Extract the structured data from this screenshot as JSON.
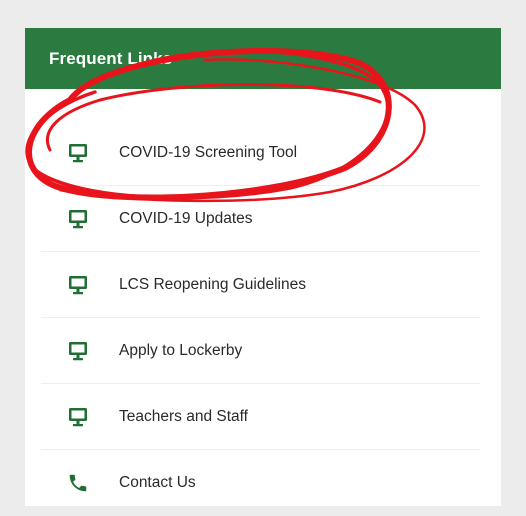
{
  "panel": {
    "title": "Frequent Links",
    "accent_color": "#2b7b40",
    "icon_color": "#1f6e33"
  },
  "links": [
    {
      "label": "COVID-19 Screening Tool",
      "icon": "monitor-icon"
    },
    {
      "label": "COVID-19 Updates",
      "icon": "monitor-icon"
    },
    {
      "label": "LCS Reopening Guidelines",
      "icon": "monitor-icon"
    },
    {
      "label": "Apply to Lockerby",
      "icon": "monitor-icon"
    },
    {
      "label": "Teachers and Staff",
      "icon": "monitor-icon"
    },
    {
      "label": "Contact Us",
      "icon": "phone-icon"
    }
  ],
  "annotation": {
    "type": "red-hand-drawn-circle",
    "color": "#e8141b",
    "target": "COVID-19 Screening Tool"
  }
}
